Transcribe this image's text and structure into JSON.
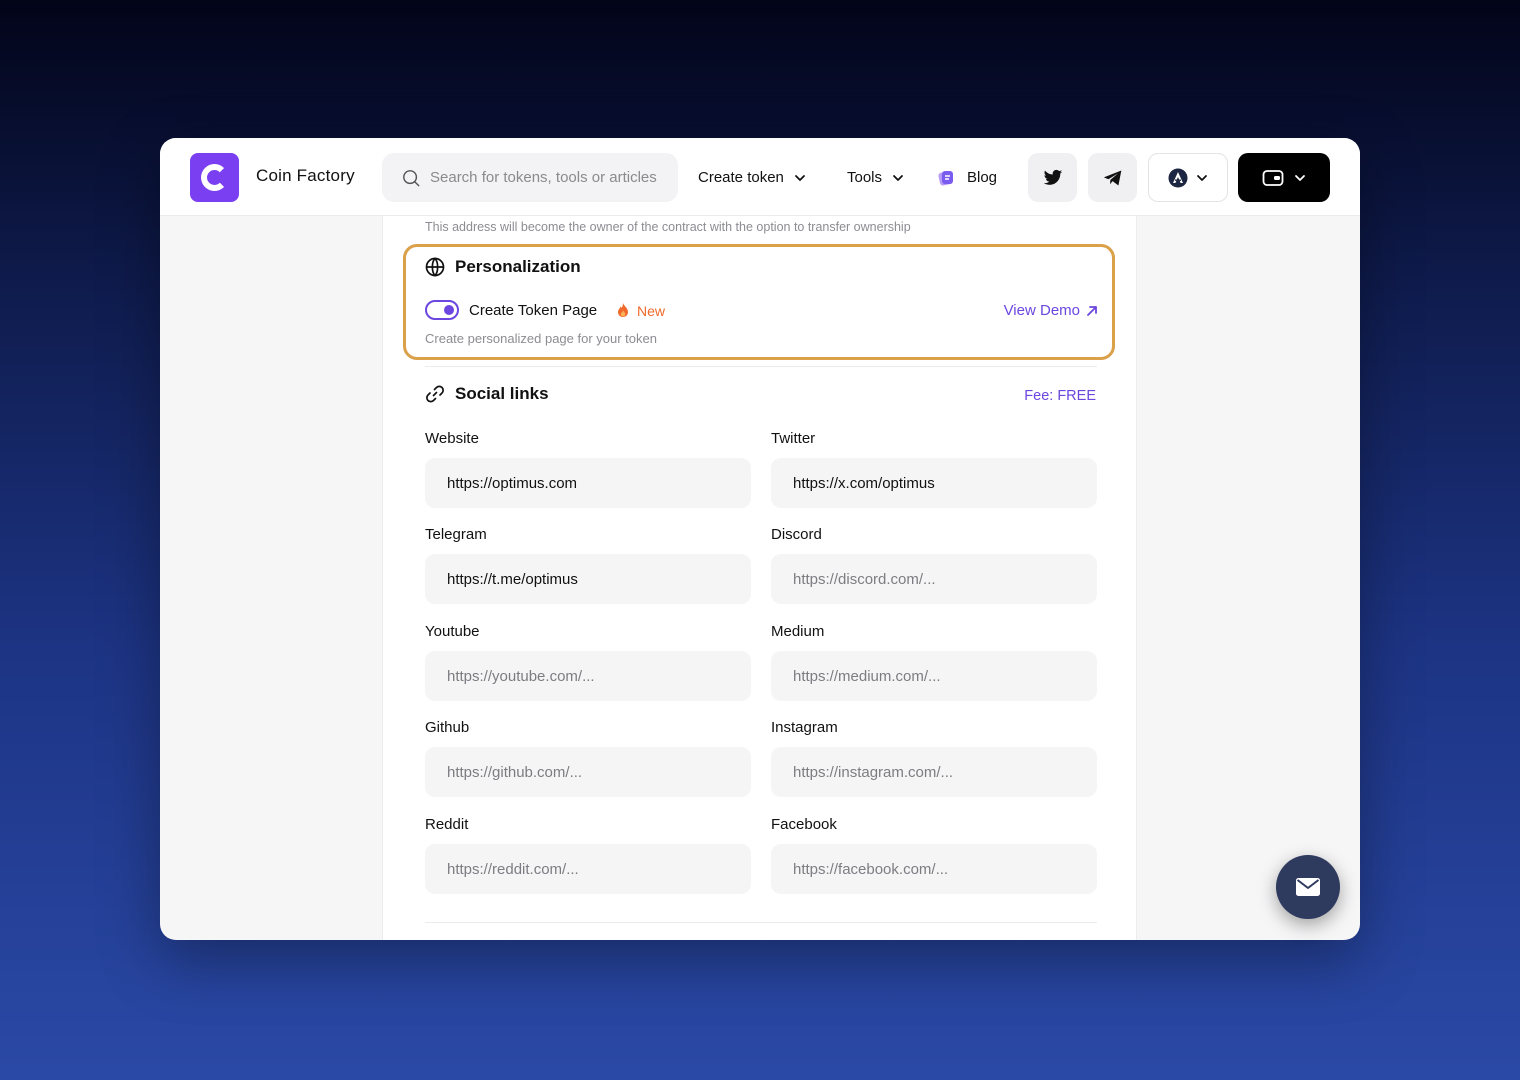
{
  "header": {
    "brand": "Coin Factory",
    "search_placeholder": "Search for tokens, tools or articles",
    "nav_create_token": "Create token",
    "nav_tools": "Tools",
    "nav_blog": "Blog"
  },
  "owner_note": "This address will become the owner of the contract with the option to transfer ownership",
  "personalization": {
    "title": "Personalization",
    "toggle_label": "Create Token Page",
    "toggle_on": true,
    "badge": "New",
    "view_demo": "View Demo",
    "description": "Create personalized page for your token",
    "highlight_color": "#daa04a"
  },
  "social": {
    "title": "Social links",
    "fee": "Fee: FREE",
    "fields": {
      "website": {
        "label": "Website",
        "value": "https://optimus.com",
        "placeholder": ""
      },
      "twitter": {
        "label": "Twitter",
        "value": "https://x.com/optimus",
        "placeholder": ""
      },
      "telegram": {
        "label": "Telegram",
        "value": "https://t.me/optimus",
        "placeholder": ""
      },
      "discord": {
        "label": "Discord",
        "value": "",
        "placeholder": "https://discord.com/..."
      },
      "youtube": {
        "label": "Youtube",
        "value": "",
        "placeholder": "https://youtube.com/..."
      },
      "medium": {
        "label": "Medium",
        "value": "",
        "placeholder": "https://medium.com/..."
      },
      "github": {
        "label": "Github",
        "value": "",
        "placeholder": "https://github.com/..."
      },
      "instagram": {
        "label": "Instagram",
        "value": "",
        "placeholder": "https://instagram.com/..."
      },
      "reddit": {
        "label": "Reddit",
        "value": "",
        "placeholder": "https://reddit.com/..."
      },
      "facebook": {
        "label": "Facebook",
        "value": "",
        "placeholder": "https://facebook.com/..."
      }
    }
  },
  "colors": {
    "accent": "#6b46e0",
    "brand": "#7b3ff2",
    "new_badge": "#f06a2c"
  },
  "icons": [
    "search-icon",
    "chevron-down-icon",
    "blog-icon",
    "twitter-icon",
    "telegram-icon",
    "network-icon",
    "wallet-icon",
    "globe-icon",
    "fire-icon",
    "arrow-up-right-icon",
    "link-icon",
    "mail-icon"
  ]
}
